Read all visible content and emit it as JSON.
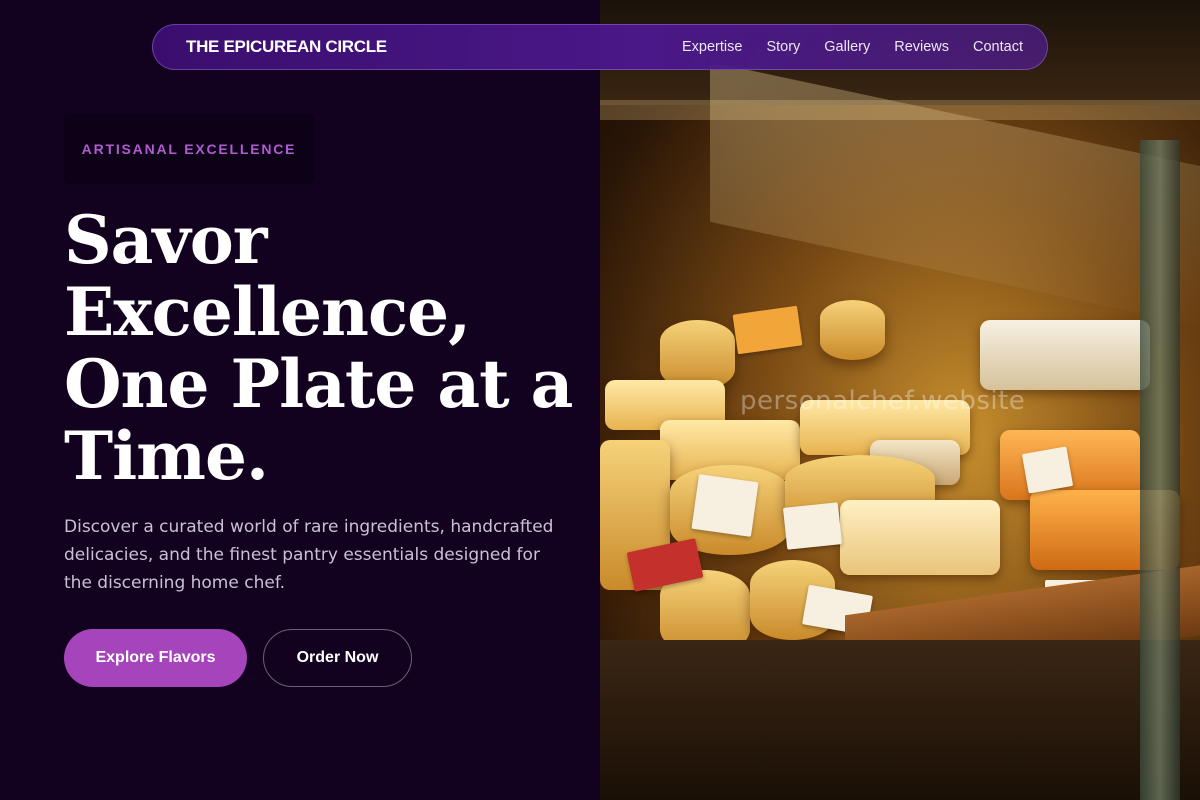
{
  "nav": {
    "brand": "THE EPICUREAN CIRCLE",
    "links": [
      "Expertise",
      "Story",
      "Gallery",
      "Reviews",
      "Contact"
    ]
  },
  "hero": {
    "badge": "ARTISANAL EXCELLENCE",
    "headline_lines": [
      "Savor",
      "Excellence,",
      "One Plate at a",
      "Time."
    ],
    "description": "Discover a curated world of rare ingredients, handcrafted delicacies, and the finest pantry essentials designed for the discerning home chef.",
    "primary_cta": "Explore Flavors",
    "secondary_cta": "Order Now"
  },
  "image": {
    "watermark": "personalchef.website"
  },
  "colors": {
    "background": "#12021f",
    "accent": "#a544bb",
    "badge_text": "#b25bd0",
    "nav": "#4a1888"
  }
}
